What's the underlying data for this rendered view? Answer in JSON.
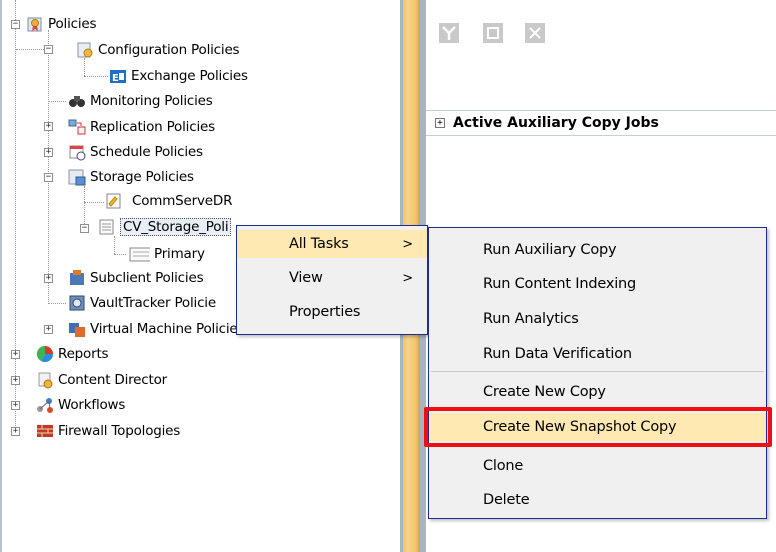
{
  "tree": {
    "policies": "Policies",
    "configuration_policies": "Configuration Policies",
    "exchange_policies": "Exchange Policies",
    "monitoring_policies": "Monitoring Policies",
    "replication_policies": "Replication Policies",
    "schedule_policies": "Schedule Policies",
    "storage_policies": "Storage Policies",
    "commserve_dr": "CommServeDR",
    "cv_storage_policy": "CV_Storage_Poli",
    "primary": "Primary",
    "subclient_policies": "Subclient Policies",
    "vaulttracker_policies": "VaultTracker Policie",
    "virtual_machine_policies": "Virtual Machine Policies",
    "reports": "Reports",
    "content_director": "Content Director",
    "workflows": "Workflows",
    "firewall_topologies": "Firewall Topologies"
  },
  "right_pane": {
    "section_title": "Active Auxiliary Copy Jobs",
    "expand_symbol": "+"
  },
  "context_menu": {
    "all_tasks": "All Tasks",
    "view": "View",
    "properties": "Properties",
    "submenu_arrow": ">"
  },
  "submenu": {
    "run_auxiliary_copy": "Run Auxiliary Copy",
    "run_content_indexing": "Run Content Indexing",
    "run_analytics": "Run Analytics",
    "run_data_verification": "Run Data Verification",
    "create_new_copy": "Create New Copy",
    "create_new_snapshot_copy": "Create New Snapshot Copy",
    "clone": "Clone",
    "delete": "Delete"
  },
  "colors": {
    "highlight": "#ffe9b3",
    "menu_border": "#1c2d8f",
    "annotation_red": "#ee1010",
    "splitter": "#f2c36a"
  },
  "icons": [
    "policies-icon",
    "configuration-policies-icon",
    "exchange-icon",
    "binoculars-icon",
    "replication-icon",
    "schedule-icon",
    "storage-policies-icon",
    "commserve-icon",
    "storage-policy-icon",
    "primary-copy-icon",
    "subclient-icon",
    "vaulttracker-icon",
    "virtual-machine-icon",
    "reports-icon",
    "content-director-icon",
    "workflows-icon",
    "firewall-icon",
    "pdf-icon",
    "export-icon",
    "excel-icon"
  ]
}
